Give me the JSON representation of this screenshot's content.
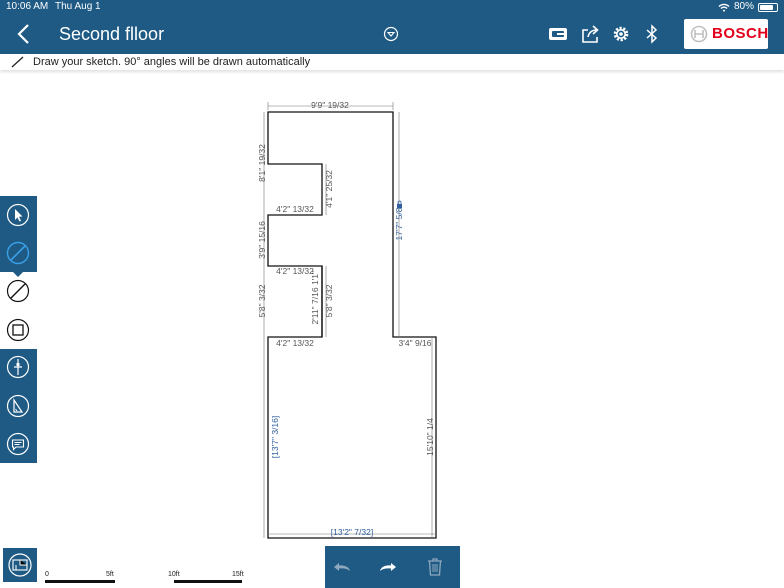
{
  "status_bar": {
    "time": "10:06 AM",
    "date": "Thu Aug 1",
    "battery": "80%",
    "battery_level": 0.8
  },
  "nav": {
    "title": "Second flloor",
    "brand": "BOSCH"
  },
  "hint": {
    "text": "Draw your sketch. 90° angles will be drawn automatically"
  },
  "dimensions": {
    "top": "9'9\" 19/32",
    "left_upper": "8'1\" 19/32",
    "notch1_depth": "4'2\" 13/32",
    "notch1_inner": "4'1\" 25/32",
    "between": "3'9\" 15/16",
    "notch2_top": "4'2\" 13/32",
    "notch2_inner": "2'11\" 7/16",
    "notch2_inner_b": "1'1\"",
    "notch2_left": "5'8\" 3/32",
    "notch2_right": "5'8\" 3/32",
    "notch2_bottom": "4'2\" 13/32",
    "right_upper": "17'7\" 5/8",
    "step": "3'4\" 9/16",
    "right_lower": "15'10\" 1/4",
    "left_lower": "[13'7\" 3/16]",
    "bottom": "[13'2\" 7/32]"
  },
  "scale_bar": {
    "labels": [
      "0",
      "5ft",
      "10ft",
      "15ft"
    ]
  },
  "colors": {
    "primary": "#1e5a84",
    "brand_red": "#e2001a",
    "dim_text": "#555555",
    "dim_blue": "#2f5f9e"
  },
  "icons": {
    "nav": [
      "back-icon",
      "dropdown-icon",
      "laser-icon",
      "share-icon",
      "gear-icon",
      "bluetooth-icon"
    ],
    "tools": [
      "cursor-icon",
      "draw-icon",
      "line-icon",
      "rectangle-icon",
      "measure-icon",
      "angle-icon",
      "comment-icon"
    ],
    "bottom": [
      "floorplan-icon",
      "undo-icon",
      "redo-icon",
      "trash-icon"
    ]
  }
}
